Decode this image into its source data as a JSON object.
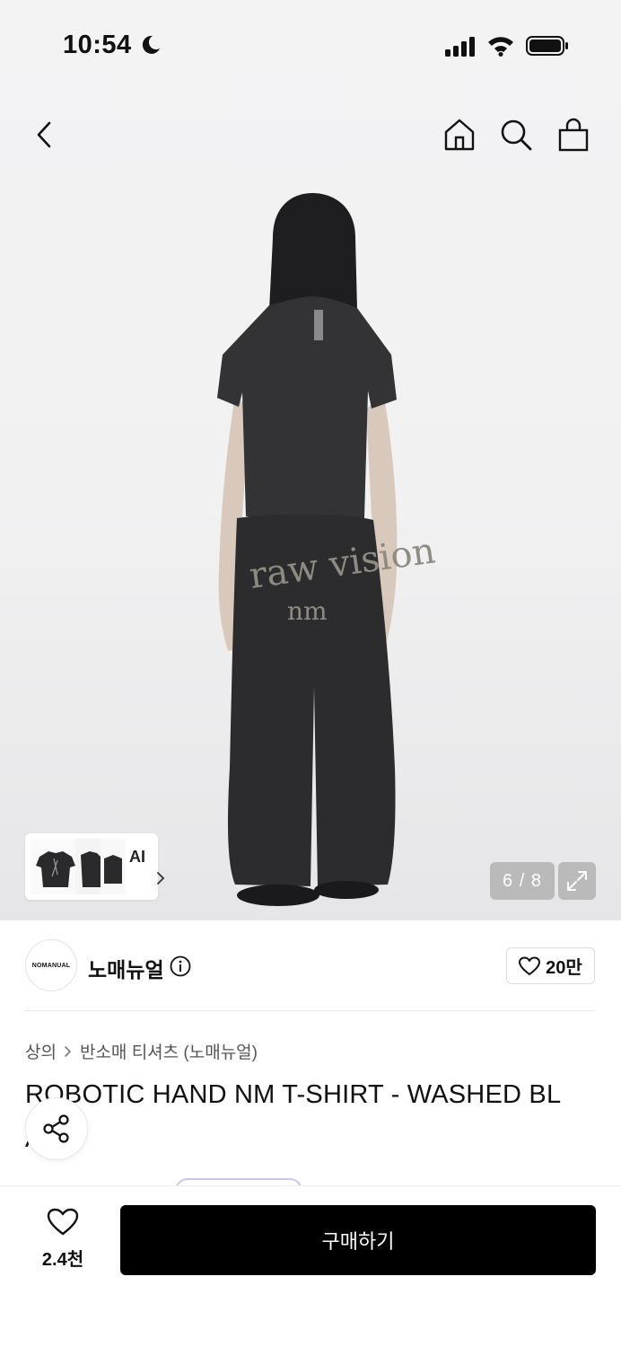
{
  "status_bar": {
    "time": "10:54"
  },
  "nav": {
    "icons": [
      "back-icon",
      "home-icon",
      "search-icon",
      "cart-icon"
    ]
  },
  "gallery": {
    "counter": "6 / 8",
    "ai_label": "AI"
  },
  "brand": {
    "logo_text": "NOMANUAL",
    "name": "노매뉴얼",
    "likes": "20만"
  },
  "breadcrumb": {
    "category": "상의",
    "subcategory": "반소매 티셔츠 (노매뉴얼)"
  },
  "product": {
    "title_line1": "ROBOTIC HAND NM T-SHIRT - WASHED BL",
    "title_line2": "A"
  },
  "bottom_bar": {
    "wish_count": "2.4천",
    "buy_label": "구매하기"
  },
  "colors": {
    "accent": "#000000",
    "peek_border": "#c9c4f2"
  }
}
